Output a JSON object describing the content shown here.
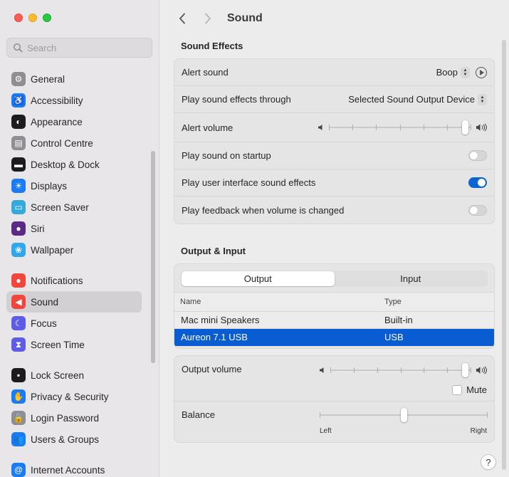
{
  "window": {
    "title": "Sound"
  },
  "search": {
    "placeholder": "Search"
  },
  "sidebar": {
    "groups": [
      [
        {
          "label": "General",
          "icon": "gear-icon",
          "color": "#8e8e93"
        },
        {
          "label": "Accessibility",
          "icon": "accessibility-icon",
          "color": "#1a7cf5"
        },
        {
          "label": "Appearance",
          "icon": "appearance-icon",
          "color": "#1c1c1e"
        },
        {
          "label": "Control Centre",
          "icon": "control-centre-icon",
          "color": "#8e8e93"
        },
        {
          "label": "Desktop & Dock",
          "icon": "desktop-dock-icon",
          "color": "#1c1c1e"
        },
        {
          "label": "Displays",
          "icon": "displays-icon",
          "color": "#1a7cf5"
        },
        {
          "label": "Screen Saver",
          "icon": "screen-saver-icon",
          "color": "#34aadc"
        },
        {
          "label": "Siri",
          "icon": "siri-icon",
          "color": "#5b2a86"
        },
        {
          "label": "Wallpaper",
          "icon": "wallpaper-icon",
          "color": "#2fa7e8"
        }
      ],
      [
        {
          "label": "Notifications",
          "icon": "notifications-icon",
          "color": "#f0463c"
        },
        {
          "label": "Sound",
          "icon": "sound-icon",
          "color": "#f0463c",
          "active": true
        },
        {
          "label": "Focus",
          "icon": "focus-icon",
          "color": "#5e5ce6"
        },
        {
          "label": "Screen Time",
          "icon": "screen-time-icon",
          "color": "#5e5ce6"
        }
      ],
      [
        {
          "label": "Lock Screen",
          "icon": "lock-screen-icon",
          "color": "#1c1c1e"
        },
        {
          "label": "Privacy & Security",
          "icon": "privacy-icon",
          "color": "#1a7cf5"
        },
        {
          "label": "Login Password",
          "icon": "login-password-icon",
          "color": "#8e8e93"
        },
        {
          "label": "Users & Groups",
          "icon": "users-groups-icon",
          "color": "#1a7cf5"
        }
      ],
      [
        {
          "label": "Internet Accounts",
          "icon": "internet-accounts-icon",
          "color": "#1a7cf5"
        }
      ]
    ]
  },
  "sound_effects": {
    "title": "Sound Effects",
    "alert_sound_label": "Alert sound",
    "alert_sound_value": "Boop",
    "play_through_label": "Play sound effects through",
    "play_through_value": "Selected Sound Output Device",
    "alert_volume_label": "Alert volume",
    "alert_volume_level": 0.98,
    "startup_label": "Play sound on startup",
    "startup_on": false,
    "ui_effects_label": "Play user interface sound effects",
    "ui_effects_on": true,
    "feedback_label": "Play feedback when volume is changed",
    "feedback_on": false
  },
  "output_input": {
    "title": "Output & Input",
    "tabs": [
      "Output",
      "Input"
    ],
    "selected_tab": "Output",
    "columns": {
      "name": "Name",
      "type": "Type"
    },
    "devices": [
      {
        "name": "Mac mini Speakers",
        "type": "Built-in",
        "selected": false
      },
      {
        "name": "Aureon 7.1 USB",
        "type": "USB",
        "selected": true
      }
    ],
    "output_volume_label": "Output volume",
    "output_volume_level": 0.98,
    "mute_label": "Mute",
    "mute_checked": false,
    "balance_label": "Balance",
    "balance_left": "Left",
    "balance_right": "Right",
    "balance_level": 0.5
  },
  "help": {
    "label": "?"
  },
  "accent_color": "#0a64d2"
}
